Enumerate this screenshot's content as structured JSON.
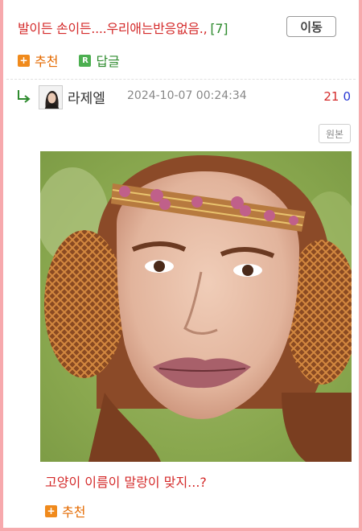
{
  "post": {
    "title": "발이든 손이든....우리애는반응없음.,",
    "comment_count": "[7]",
    "move_button_label": "이동"
  },
  "actions": {
    "recommend_label": "추천",
    "reply_label": "답글",
    "plus_icon": "+",
    "reply_icon": "R"
  },
  "comment": {
    "nickname": "라제엘",
    "timestamp": "2024-10-07 00:24:34",
    "upvotes": "21",
    "downvotes": "0",
    "original_label": "원본",
    "image_caption": "고양이 이름이 말랑이 맞지...?",
    "recommend_label": "추천"
  },
  "colors": {
    "frame_border": "#f7a9ad",
    "title_red": "#d42a2a",
    "count_green": "#2e8b2e",
    "recommend_orange": "#e46a00",
    "reply_green": "#2e8b2e",
    "down_blue": "#2a3ad4"
  }
}
